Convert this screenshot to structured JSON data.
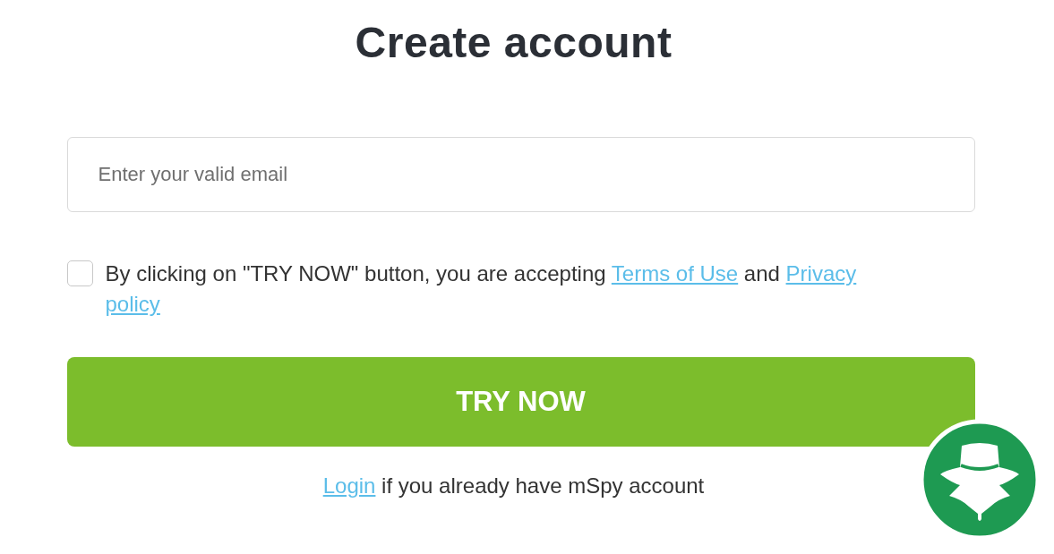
{
  "title": "Create account",
  "email_field": {
    "placeholder": "Enter your valid email"
  },
  "consent": {
    "checked": false,
    "text_before": "By clicking on \"TRY NOW\" button, you are accepting ",
    "terms_link": "Terms of Use",
    "text_between": " and ",
    "privacy_link_lines": [
      "Privacy",
      "policy"
    ]
  },
  "submit_button": "TRY NOW",
  "login_line": {
    "link": "Login",
    "text": " if you already have mSpy account"
  }
}
